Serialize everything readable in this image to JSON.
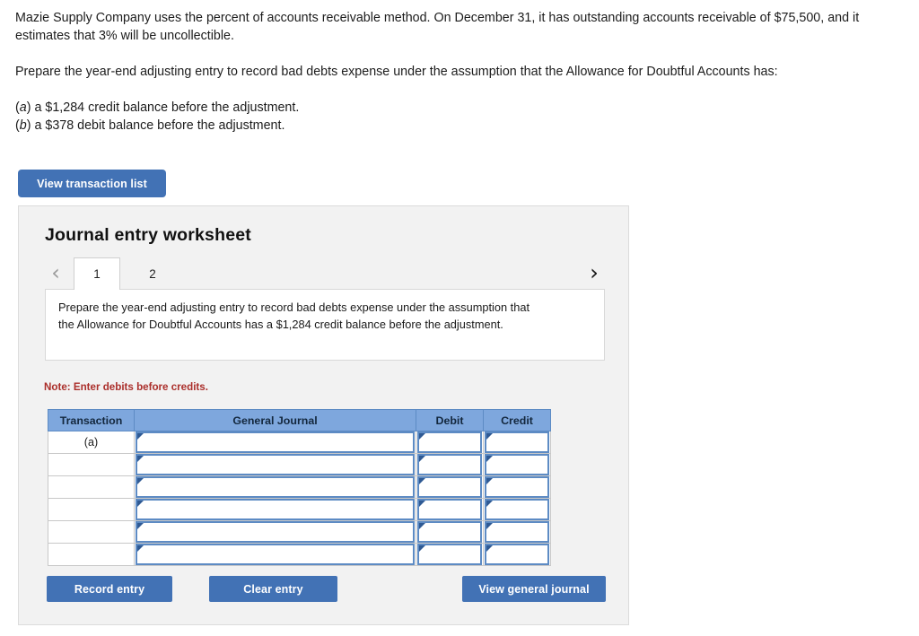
{
  "problem": {
    "para1_a": "Mazie Supply Company uses the percent of accounts receivable method. On December 31, it has outstanding accounts receivable of $75,500, and it estimates that 3% will be uncollectible.",
    "para2": "Prepare the year-end adjusting entry to record bad debts expense under the assumption that the Allowance for Doubtful Accounts has:",
    "item_a_label": "a",
    "item_a_text": ") a $1,284 credit balance before the adjustment.",
    "item_b_label": "b",
    "item_b_text": ") a $378 debit balance before the adjustment.",
    "paren_open": "("
  },
  "toolbar": {
    "view_transaction_list_label": "View transaction list"
  },
  "worksheet": {
    "title": "Journal entry worksheet",
    "prev_icon": "chevron-left-icon",
    "next_icon": "chevron-right-icon",
    "prev_glyph": "‹",
    "next_glyph": "›",
    "tabs": [
      {
        "label": "1",
        "active": true
      },
      {
        "label": "2",
        "active": false
      }
    ],
    "instruction": "Prepare the year-end adjusting entry to record bad debts expense under the assumption that the Allowance for Doubtful Accounts has a $1,284 credit balance before the adjustment.",
    "note": "Note: Enter debits before credits.",
    "note_color": "#ab2f2b"
  },
  "table": {
    "columns": [
      "Transaction",
      "General Journal",
      "Debit",
      "Credit"
    ],
    "rows": [
      {
        "transaction": "(a)",
        "general_journal": "",
        "debit": "",
        "credit": ""
      },
      {
        "transaction": "",
        "general_journal": "",
        "debit": "",
        "credit": ""
      },
      {
        "transaction": "",
        "general_journal": "",
        "debit": "",
        "credit": ""
      },
      {
        "transaction": "",
        "general_journal": "",
        "debit": "",
        "credit": ""
      },
      {
        "transaction": "",
        "general_journal": "",
        "debit": "",
        "credit": ""
      },
      {
        "transaction": "",
        "general_journal": "",
        "debit": "",
        "credit": ""
      }
    ],
    "header_color": "#7ea7dd",
    "cell_border_color": "#5d8bc4"
  },
  "actions": {
    "record_entry_label": "Record entry",
    "clear_entry_label": "Clear entry",
    "view_general_journal_label": "View general journal",
    "button_color": "#4272b5"
  }
}
